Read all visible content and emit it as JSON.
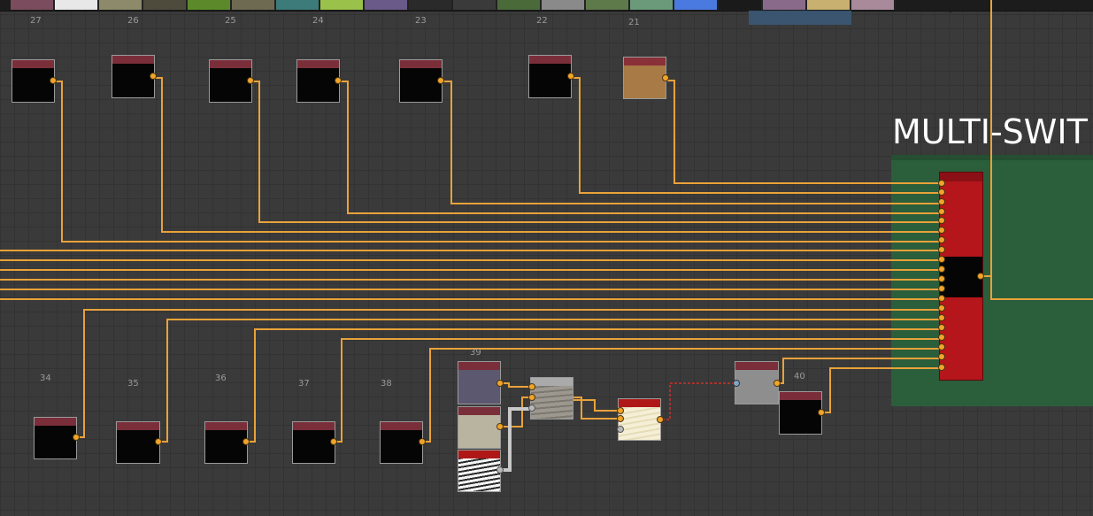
{
  "frame": {
    "title": "MULTI-SWIT"
  },
  "toolbar": {
    "swatches": [
      "#7a4c5e",
      "#e8e8e8",
      "#8c8a6a",
      "#4e4a3c",
      "#5c8a2a",
      "#6e6a52",
      "#3d7a7a",
      "#9ac24a",
      "#6a5a8a",
      "#2a2a2a",
      "#3a3a3a",
      "#4a6a3a",
      "#8a8a8a",
      "#5e7a4a",
      "#6a9a7a",
      "#4a7ae0",
      "#1a1a1a",
      "#8a6a8a",
      "#c8b070",
      "#a88a9a"
    ]
  },
  "nodes_top": [
    {
      "id": "27"
    },
    {
      "id": "26"
    },
    {
      "id": "25"
    },
    {
      "id": "24"
    },
    {
      "id": "23"
    },
    {
      "id": "22"
    },
    {
      "id": "21"
    }
  ],
  "nodes_bottom": [
    {
      "id": "34"
    },
    {
      "id": "35"
    },
    {
      "id": "36"
    },
    {
      "id": "37"
    },
    {
      "id": "38"
    }
  ],
  "graph_nodes": {
    "stack_id": "39",
    "right_id": "40"
  },
  "colors": {
    "wire": "#e8a23a",
    "frame": "#2b5e3b",
    "switch": "#b4161b",
    "node_header": "#7a2e3a",
    "dashed_link": "#d0302a"
  }
}
